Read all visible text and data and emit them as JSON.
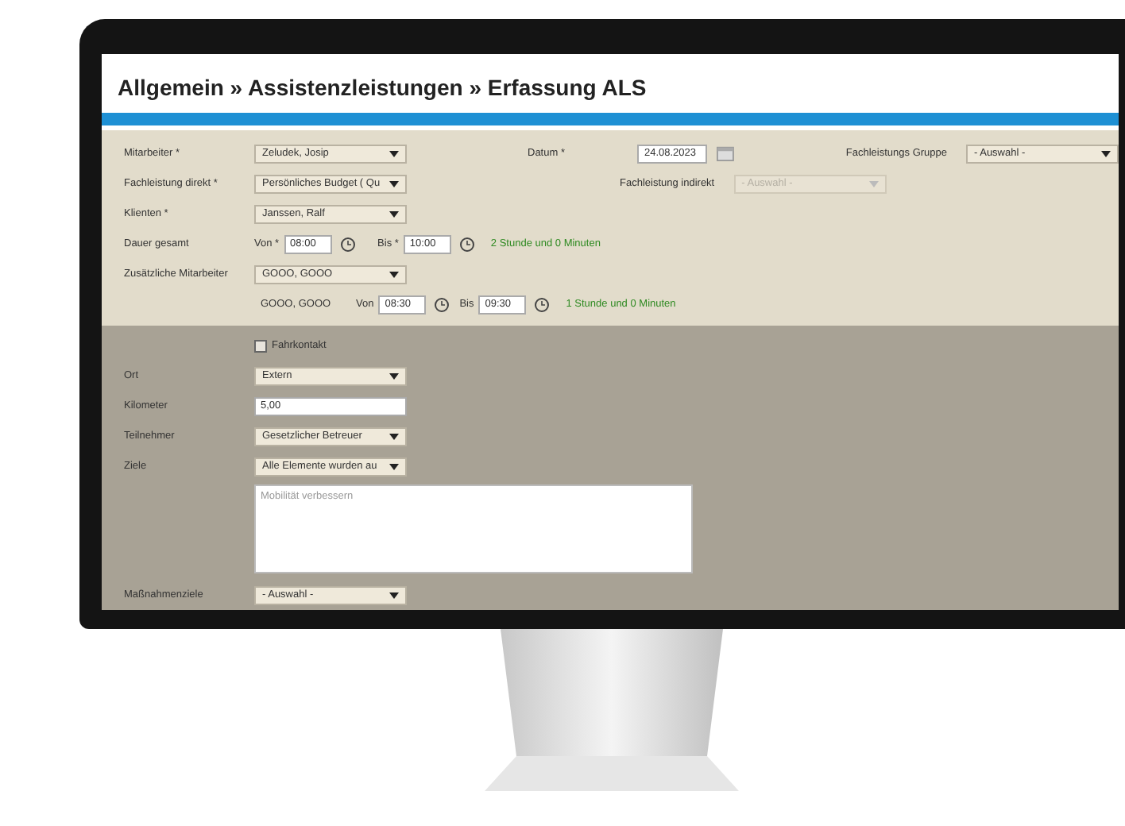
{
  "title": "Allgemein » Assistenzleistungen » Erfassung ALS",
  "mitarbeiter": {
    "label": "Mitarbeiter *",
    "value": "Zeludek, Josip"
  },
  "datum": {
    "label": "Datum *",
    "value": "24.08.2023"
  },
  "fachleistungs_gruppe": {
    "label": "Fachleistungs Gruppe",
    "value": "- Auswahl -"
  },
  "fachleistung_direkt": {
    "label": "Fachleistung direkt *",
    "value": "Persönliches Budget ( Qu"
  },
  "fachleistung_indirekt": {
    "label": "Fachleistung indirekt",
    "value": "- Auswahl -",
    "disabled": true
  },
  "klienten": {
    "label": "Klienten *",
    "value": "Janssen, Ralf"
  },
  "dauer": {
    "label": "Dauer gesamt",
    "from_label": "Von *",
    "from": "08:00",
    "to_label": "Bis *",
    "to": "10:00",
    "summary": "2 Stunde und 0 Minuten"
  },
  "zusatz": {
    "label": "Zusätzliche Mitarbeiter",
    "value": "GOOO, GOOO"
  },
  "zusatz_zeit": {
    "name": "GOOO, GOOO",
    "from_label": "Von",
    "from": "08:30",
    "to_label": "Bis",
    "to": "09:30",
    "summary": "1 Stunde und 0 Minuten"
  },
  "fahrkontakt": {
    "label": "Fahrkontakt",
    "checked": false
  },
  "lower_fields": [
    {
      "kind": "select",
      "label": "Ort",
      "value": "Extern"
    },
    {
      "kind": "input",
      "label": "Kilometer",
      "value": "5,00"
    },
    {
      "kind": "select",
      "label": "Teilnehmer",
      "value": "Gesetzlicher Betreuer"
    },
    {
      "kind": "select",
      "label": "Ziele",
      "value": "Alle Elemente wurden au"
    },
    {
      "kind": "textarea",
      "placeholder": "Mobilität verbessern"
    },
    {
      "kind": "select",
      "label": "Maßnahmenziele",
      "value": "- Auswahl -"
    }
  ]
}
